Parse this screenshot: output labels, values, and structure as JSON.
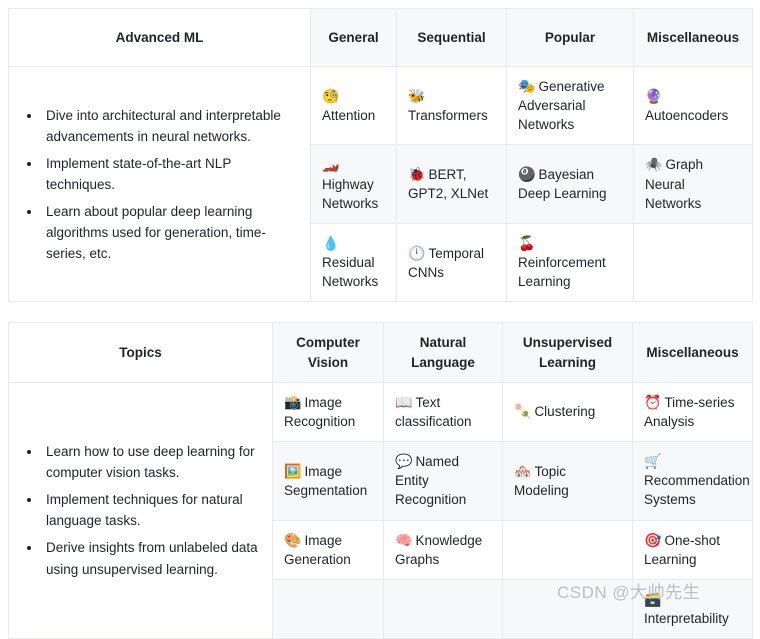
{
  "tables": [
    {
      "id": "advanced-ml-table",
      "lead_header": "Advanced ML",
      "headers": [
        "General",
        "Sequential",
        "Popular",
        "Miscellaneous"
      ],
      "bullets": [
        "Dive into architectural and interpretable advancements in neural networks.",
        "Implement state-of-the-art NLP techniques.",
        "Learn about popular deep learning algorithms used for generation, time-series, etc."
      ],
      "rows": [
        [
          {
            "emoji": "🧐",
            "icon_name": "monocle-face-icon",
            "label": "Attention"
          },
          {
            "emoji": "🐝",
            "icon_name": "honeybee-icon",
            "label": "Transformers"
          },
          {
            "emoji": "🎭",
            "icon_name": "performing-arts-icon",
            "label": "Generative Adversarial Networks"
          },
          {
            "emoji": "🔮",
            "icon_name": "crystal-ball-icon",
            "label": "Autoencoders"
          }
        ],
        [
          {
            "emoji": "🏎️",
            "icon_name": "racing-car-icon",
            "label": "Highway Networks"
          },
          {
            "emoji": "🐞",
            "icon_name": "ladybug-icon",
            "label": "BERT, GPT2, XLNet"
          },
          {
            "emoji": "🎱",
            "icon_name": "pool-8-ball-icon",
            "label": "Bayesian Deep Learning"
          },
          {
            "emoji": "🕷️",
            "icon_name": "spider-icon",
            "label": "Graph Neural Networks"
          }
        ],
        [
          {
            "emoji": "💧",
            "icon_name": "droplet-icon",
            "label": "Residual Networks"
          },
          {
            "emoji": "🕛",
            "icon_name": "clock-icon",
            "label": "Temporal CNNs"
          },
          {
            "emoji": "🍒",
            "icon_name": "cherries-icon",
            "label": "Reinforcement Learning"
          },
          {
            "emoji": "",
            "icon_name": "",
            "label": ""
          }
        ]
      ]
    },
    {
      "id": "topics-table",
      "lead_header": "Topics",
      "headers": [
        "Computer Vision",
        "Natural Language",
        "Unsupervised Learning",
        "Miscellaneous"
      ],
      "bullets": [
        "Learn how to use deep learning for computer vision tasks.",
        "Implement techniques for natural language tasks.",
        "Derive insights from unlabeled data using unsupervised learning."
      ],
      "rows": [
        [
          {
            "emoji": "📸",
            "icon_name": "camera-with-flash-icon",
            "label": "Image Recognition"
          },
          {
            "emoji": "📖",
            "icon_name": "open-book-icon",
            "label": "Text classification"
          },
          {
            "emoji": "🍡",
            "icon_name": "dango-icon",
            "label": "Clustering"
          },
          {
            "emoji": "⏰",
            "icon_name": "alarm-clock-icon",
            "label": "Time-series Analysis"
          }
        ],
        [
          {
            "emoji": "🖼️",
            "icon_name": "framed-picture-icon",
            "label": "Image Segmentation"
          },
          {
            "emoji": "💬",
            "icon_name": "speech-balloon-icon",
            "label": "Named Entity Recognition"
          },
          {
            "emoji": "🏘️",
            "icon_name": "houses-icon",
            "label": "Topic Modeling"
          },
          {
            "emoji": "🛒",
            "icon_name": "shopping-cart-icon",
            "label": "Recommendation Systems"
          }
        ],
        [
          {
            "emoji": "🎨",
            "icon_name": "artist-palette-icon",
            "label": "Image Generation"
          },
          {
            "emoji": "🧠",
            "icon_name": "brain-icon",
            "label": "Knowledge Graphs"
          },
          {
            "emoji": "",
            "icon_name": "",
            "label": ""
          },
          {
            "emoji": "🎯",
            "icon_name": "bullseye-icon",
            "label": "One-shot Learning"
          }
        ],
        [
          {
            "emoji": "",
            "icon_name": "",
            "label": ""
          },
          {
            "emoji": "",
            "icon_name": "",
            "label": ""
          },
          {
            "emoji": "",
            "icon_name": "",
            "label": ""
          },
          {
            "emoji": "🗃️",
            "icon_name": "card-file-box-icon",
            "label": "Interpretability"
          }
        ]
      ]
    }
  ],
  "watermark": {
    "text": "CSDN @大帅先生"
  }
}
